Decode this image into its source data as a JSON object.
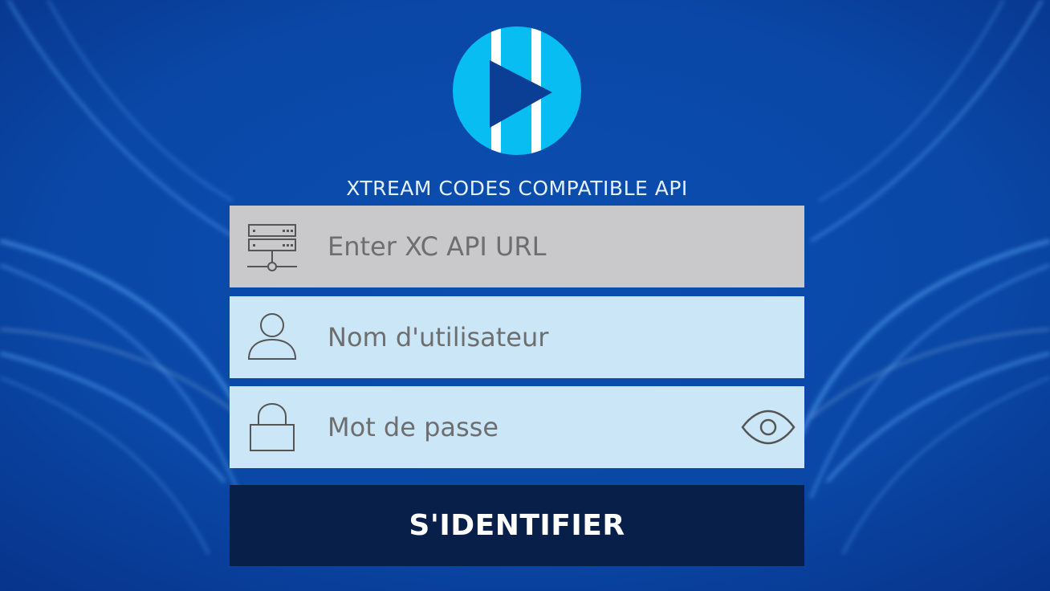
{
  "app": {
    "subtitle": "XTREAM CODES COMPATIBLE API",
    "logo_icon": "play-logo-icon"
  },
  "form": {
    "url": {
      "placeholder": "Enter XC API URL",
      "value": "",
      "icon": "server-icon"
    },
    "username": {
      "placeholder": "Nom d'utilisateur",
      "value": "",
      "icon": "user-icon"
    },
    "password": {
      "placeholder": "Mot de passe",
      "value": "",
      "icon": "lock-icon",
      "toggle_icon": "eye-icon"
    },
    "submit_label": "S'IDENTIFIER"
  },
  "colors": {
    "background": "#0a4aa8",
    "logo_circle": "#08bdf2",
    "url_field": "#c9c9cb",
    "input_field": "#cbe7f7",
    "button": "#081f49"
  }
}
